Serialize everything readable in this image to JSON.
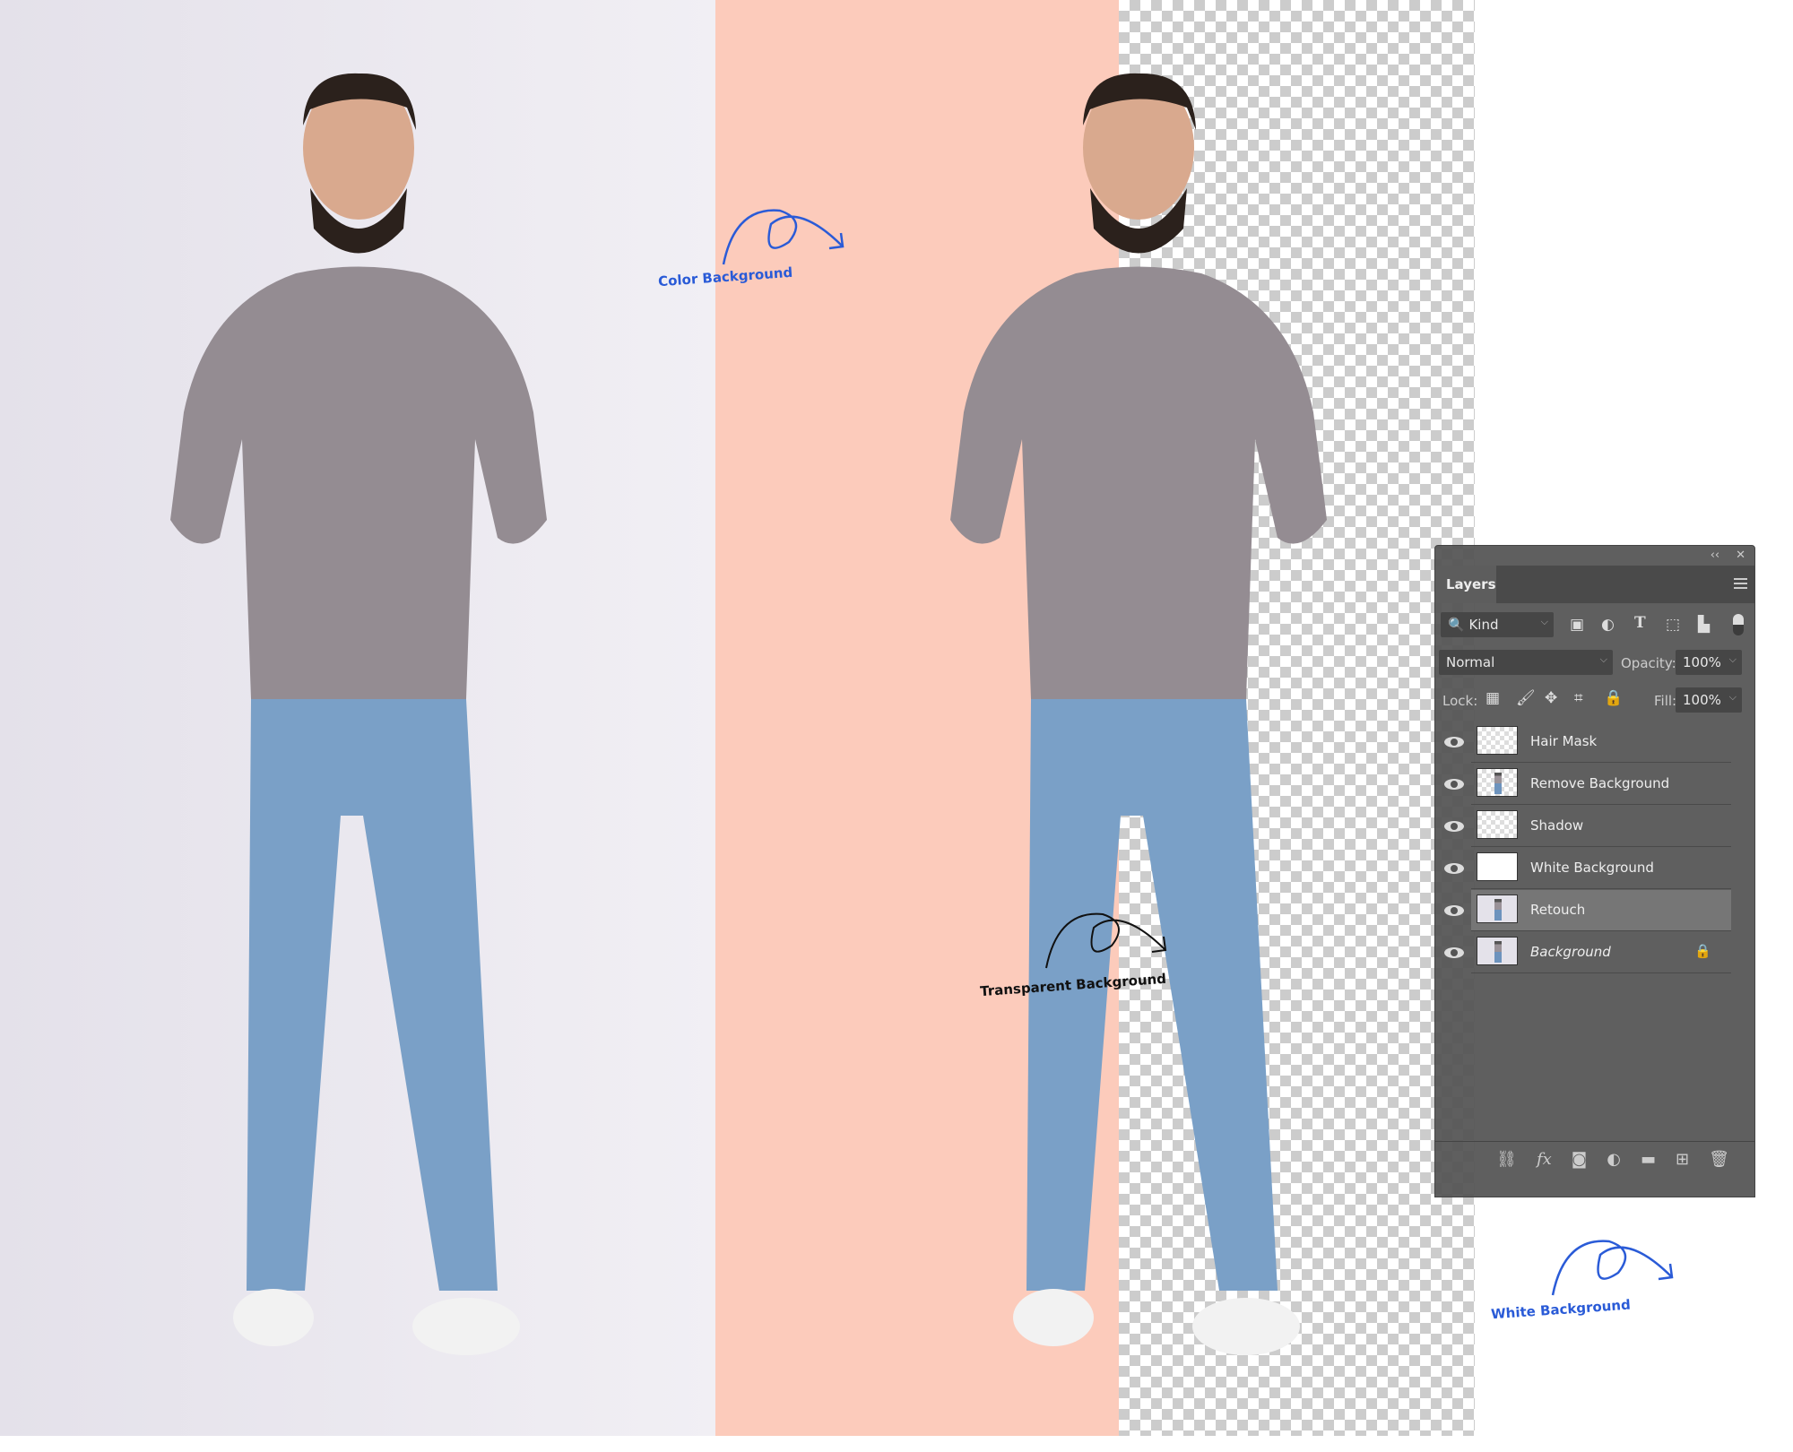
{
  "annotations": {
    "color_bg": "Color Background",
    "transparent_bg": "Transparent Background",
    "white_bg": "White Background"
  },
  "colors": {
    "accent": "#2a5bd7",
    "peach": "#fccbbb",
    "panel": "#535353"
  },
  "panel": {
    "title": "Layers",
    "filter": {
      "label": "Kind",
      "icons": [
        "image-icon",
        "adjustment-icon",
        "type-icon",
        "shape-icon",
        "smart-object-icon"
      ]
    },
    "blend_mode": "Normal",
    "opacity_label": "Opacity:",
    "opacity": "100%",
    "lock_label": "Lock:",
    "fill_label": "Fill:",
    "fill": "100%",
    "layers": [
      {
        "name": "Hair Mask",
        "visible": true,
        "thumb": "transparent"
      },
      {
        "name": "Remove Background",
        "visible": true,
        "thumb": "cutout"
      },
      {
        "name": "Shadow",
        "visible": true,
        "thumb": "transparent"
      },
      {
        "name": "White Background",
        "visible": true,
        "thumb": "white"
      },
      {
        "name": "Retouch",
        "visible": true,
        "thumb": "photo",
        "selected": true
      },
      {
        "name": "Background",
        "visible": true,
        "thumb": "photo",
        "locked": true,
        "italic": true
      }
    ],
    "bottom_icons": [
      "link-icon",
      "fx-icon",
      "mask-icon",
      "adjustment-layer-icon",
      "folder-icon",
      "new-layer-icon",
      "trash-icon"
    ]
  }
}
